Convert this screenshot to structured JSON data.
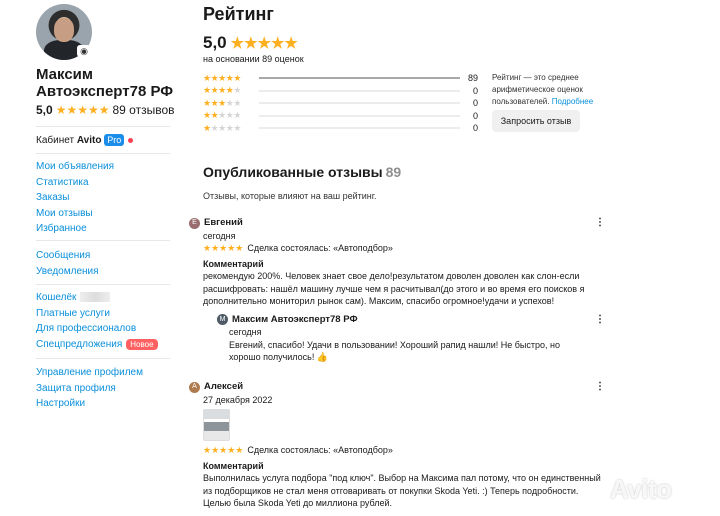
{
  "profile": {
    "name": "Максим Автоэксперт78 РФ",
    "rating": "5,0",
    "stars": "★★★★★",
    "reviews_count": "89 отзывов",
    "camera_icon": "camera-icon"
  },
  "cabinet": {
    "label": "Кабинет",
    "brand": "Avito",
    "pro": "Pro"
  },
  "menu1": [
    "Мои объявления",
    "Статистика",
    "Заказы",
    "Мои отзывы",
    "Избранное"
  ],
  "menu2": [
    "Сообщения",
    "Уведомления"
  ],
  "menu3": {
    "wallet": "Кошелёк",
    "paid": "Платные услуги",
    "pro": "Для профессионалов",
    "special": "Спецпредложения",
    "new_badge": "Новое"
  },
  "menu4": [
    "Управление профилем",
    "Защита профиля",
    "Настройки"
  ],
  "rating_section": {
    "title": "Рейтинг",
    "value": "5,0",
    "based_on": "на основании 89 оценок",
    "distribution": [
      {
        "stars": 5,
        "count": 89,
        "fraction": 1.0
      },
      {
        "stars": 4,
        "count": 0,
        "fraction": 0
      },
      {
        "stars": 3,
        "count": 0,
        "fraction": 0
      },
      {
        "stars": 2,
        "count": 0,
        "fraction": 0
      },
      {
        "stars": 1,
        "count": 0,
        "fraction": 0
      }
    ],
    "note": "Рейтинг — это среднее арифметическое оценок пользователей.",
    "note_link": "Подробнее",
    "ask_button": "Запросить отзыв"
  },
  "reviews_section": {
    "title": "Опубликованные отзывы",
    "count": "89",
    "subtitle": "Отзывы, которые влияют на ваш рейтинг."
  },
  "reviews": [
    {
      "author": "Евгений",
      "date": "сегодня",
      "deal": "Сделка состоялась: «Автоподбор»",
      "comment_label": "Комментарий",
      "comment": "рекомендую 200%. Человек знает свое дело!результатом доволен доволен как слон-если расшифровать: нашёл машину лучше чем я расчитывал(до этого и во время его поисков я дополнительно мониторил рынок сам). Максим, спасибо огромное!удачи и успехов!",
      "reply": {
        "author": "Максим Автоэксперт78 РФ",
        "date": "сегодня",
        "text": "Евгений, спасибо! Удачи в пользовании! Хороший рапид нашли! Не быстро, но хорошо получилось! 👍"
      }
    },
    {
      "author": "Алексей",
      "date": "27 декабря 2022",
      "deal": "Сделка состоялась: «Автоподбор»",
      "comment_label": "Комментарий",
      "comment": "Выполнилась услуга подбора \"под ключ\". Выбор на Максима пал потому, что он единственный из подборщиков не стал меня отговаривать от покупки Skoda Yeti. :) Теперь подробности. Целью была Skoda Yeti до миллиона рублей."
    }
  ],
  "watermark": "Avito"
}
